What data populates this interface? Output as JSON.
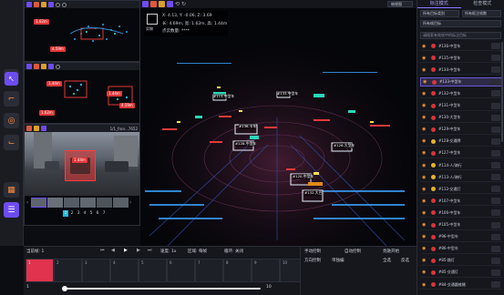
{
  "left_tools": [
    {
      "name": "select-tool-icon",
      "glyph": "↖",
      "active": true
    },
    {
      "name": "corner-tool-icon",
      "glyph": "⌐",
      "active": false
    },
    {
      "name": "target-tool-icon",
      "glyph": "◎",
      "active": false
    },
    {
      "name": "crop-tool-icon",
      "glyph": "⌙",
      "active": false
    },
    {
      "name": "grid-view-icon",
      "glyph": "▦",
      "active": false
    },
    {
      "name": "list-view-icon",
      "glyph": "☰",
      "active": true
    }
  ],
  "top_view": {
    "toolbar_label": "顶视图",
    "tags": [
      "1.62m",
      "4.59m"
    ]
  },
  "front_view": {
    "tags": [
      "1.44m",
      "1.44m",
      "1.62m",
      "4.59m"
    ]
  },
  "camera_view": {
    "title": "1/1_fron...7652",
    "tag": "1.44m",
    "pages": [
      "1",
      "2",
      "3",
      "4",
      "5",
      "6",
      "7"
    ],
    "active_page": "1"
  },
  "main_view": {
    "info_line1": "X: 4.13,  Y: -0.06,  Z: 3.69",
    "info_line2": "长: 4.69m,  宽: 1.62m,  高: 1.44m",
    "info_line3": "点云数量: ****",
    "info_prefix": "实物",
    "view_select": "俯视图",
    "labels": [
      "#136-卡车",
      "#128-中型车",
      "#126-大型车",
      "#133-中型车",
      "#113-中型车",
      "#120-中型车",
      "#132-大巴"
    ]
  },
  "right_panel": {
    "tabs": [
      "标注模式",
      "检查模式"
    ],
    "active_tab": "标注模式",
    "filter1": "所有目标类别",
    "filter2": "所有框注帧数",
    "filter3": "所有帧目标",
    "search_hint": "请搜索有效帧中的标注目标",
    "objects": [
      {
        "label": "#136-中型车",
        "color": "#d93535",
        "active": false
      },
      {
        "label": "#135-中型车",
        "color": "#d93535",
        "active": false
      },
      {
        "label": "#134-中型车",
        "color": "#d93535",
        "active": false
      },
      {
        "label": "#133-中型车",
        "color": "#d93535",
        "active": true
      },
      {
        "label": "#132-中型车",
        "color": "#d93535",
        "active": false
      },
      {
        "label": "#131-中型车",
        "color": "#d93535",
        "active": false
      },
      {
        "label": "#130-大型车",
        "color": "#d93535",
        "active": false
      },
      {
        "label": "#129-中型车",
        "color": "#d93535",
        "active": false
      },
      {
        "label": "#128-交通牌",
        "color": "#e6b22a",
        "active": false
      },
      {
        "label": "#127-中型车",
        "color": "#d93535",
        "active": false
      },
      {
        "label": "#114-人/骑行",
        "color": "#e6b22a",
        "active": false
      },
      {
        "label": "#113-人/骑行",
        "color": "#e6b22a",
        "active": false
      },
      {
        "label": "#112-交通灯",
        "color": "#e6b22a",
        "active": false
      },
      {
        "label": "#107-中型车",
        "color": "#d93535",
        "active": false
      },
      {
        "label": "#106-中型车",
        "color": "#d93535",
        "active": false
      },
      {
        "label": "#105-中型车",
        "color": "#d93535",
        "active": false
      },
      {
        "label": "#96-中型车",
        "color": "#d93535",
        "active": false
      },
      {
        "label": "#86-中型车",
        "color": "#d93535",
        "active": false
      },
      {
        "label": "#85-路灯",
        "color": "#d93535",
        "active": false
      },
      {
        "label": "#85-交通灯",
        "color": "#d93535",
        "active": false
      },
      {
        "label": "#84-交通圆锥桶",
        "color": "#d93535",
        "active": false
      }
    ]
  },
  "bottom_bar": {
    "frame_label": "当前帧: 1",
    "speed_label": "速度: 1x",
    "interval_label": "区域: 每帧",
    "loop_label": "循环: 关闭",
    "opt_manual": "手动控制",
    "opt_auto": "自动控制",
    "opt_fusion": "亮融开始",
    "opt_view": "方向控制",
    "opt_edit": "单独编",
    "opt_a": "全选",
    "opt_b": "反选",
    "frames": [
      "1",
      "2",
      "3",
      "4",
      "5",
      "6",
      "7",
      "8",
      "9",
      "10"
    ],
    "active_frame": "1",
    "slider_start": "1",
    "slider_end": "10"
  }
}
